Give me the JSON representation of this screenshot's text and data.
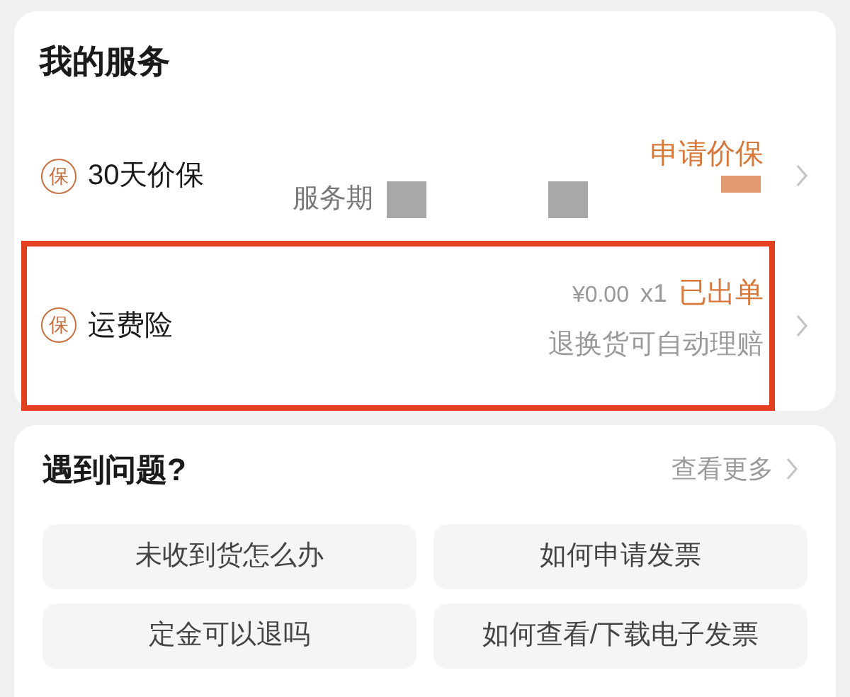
{
  "services": {
    "title": "我的服务",
    "items": [
      {
        "kind": "price_protection",
        "badge": "保",
        "label": "30天价保",
        "action": "申请价保",
        "note": "服务期",
        "highlighted": false
      },
      {
        "kind": "insurance",
        "badge": "保",
        "label": "运费险",
        "price": "¥0.00",
        "quantity": "x1",
        "status": "已出单",
        "note": "退换货可自动理赔",
        "highlighted": true
      }
    ]
  },
  "help": {
    "title": "遇到问题?",
    "more": "查看更多",
    "questions": [
      "未收到货怎么办",
      "如何申请发票",
      "定金可以退吗",
      "如何查看/下载电子发票"
    ]
  }
}
